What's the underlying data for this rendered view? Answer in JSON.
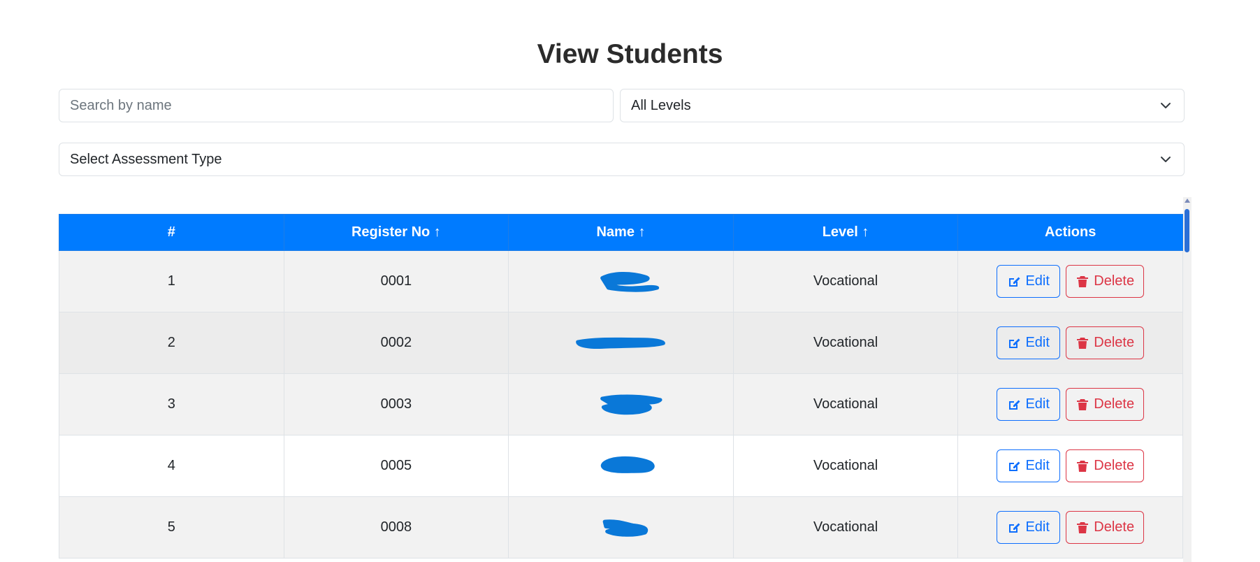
{
  "page": {
    "title": "View Students"
  },
  "filters": {
    "search_placeholder": "Search by name",
    "level_selected": "All Levels",
    "assessment_selected": "Select Assessment Type"
  },
  "table": {
    "headers": [
      "#",
      "Register No ↑",
      "Name ↑",
      "Level ↑",
      "Actions"
    ],
    "rows": [
      {
        "index": "1",
        "register_no": "0001",
        "name": "",
        "level": "Vocational"
      },
      {
        "index": "2",
        "register_no": "0002",
        "name": "",
        "level": "Vocational"
      },
      {
        "index": "3",
        "register_no": "0003",
        "name": "",
        "level": "Vocational"
      },
      {
        "index": "4",
        "register_no": "0005",
        "name": "",
        "level": "Vocational"
      },
      {
        "index": "5",
        "register_no": "0008",
        "name": "",
        "level": "Vocational"
      }
    ],
    "edit_label": "Edit",
    "delete_label": "Delete"
  },
  "colors": {
    "header_bg": "#007bff",
    "edit": "#0d6efd",
    "delete": "#dc3545",
    "redaction": "#0a78d8"
  },
  "icons": {
    "edit": "pen-square-icon",
    "delete": "trash-icon",
    "dropdown": "chevron-down-icon"
  }
}
